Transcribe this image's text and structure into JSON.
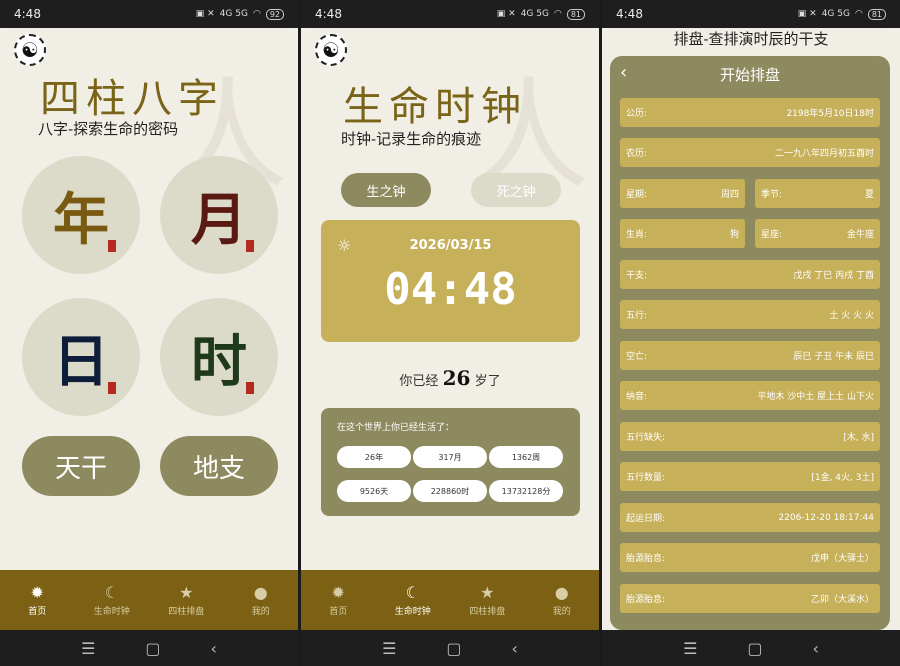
{
  "status": {
    "time": "4:48",
    "battery_1": "92",
    "battery_2": "81",
    "battery_3": "81",
    "signal": "4G 5G"
  },
  "screen1": {
    "title": "四柱八字",
    "subtitle": "八字-探索生命的密码",
    "circles": [
      "年",
      "月",
      "日",
      "时"
    ],
    "pills": [
      "天干",
      "地支"
    ]
  },
  "tabs": [
    {
      "label": "首页",
      "icon": "sun-icon"
    },
    {
      "label": "生命时钟",
      "icon": "moon-icon"
    },
    {
      "label": "四柱排盘",
      "icon": "star-icon"
    },
    {
      "label": "我的",
      "icon": "person-icon"
    }
  ],
  "screen2": {
    "title": "生命时钟",
    "subtitle": "时钟-记录生命的痕迹",
    "btn_life": "生之钟",
    "btn_death": "死之钟",
    "date": "2026/03/15",
    "time": "04:48",
    "age_prefix": "你已经",
    "age_value": "26",
    "age_suffix": "岁了",
    "life_header": "在这个世界上你已经生活了：",
    "life_stats": [
      "26年",
      "317月",
      "1362周",
      "9526天",
      "228860时",
      "13732128分"
    ]
  },
  "screen3": {
    "title": "排盘-查排演时辰的干支",
    "header": "开始排盘",
    "rows": [
      {
        "label": "公历:",
        "value": "2198年5月10日18时"
      },
      {
        "label": "农历:",
        "value": "二一九八年四月初五酉时"
      },
      {
        "label": "星期:",
        "value": "周四",
        "label2": "季节:",
        "value2": "夏"
      },
      {
        "label": "生肖:",
        "value": "狗",
        "label2": "星座:",
        "value2": "金牛座"
      },
      {
        "label": "干支:",
        "value": "戊戌 丁巳 丙戌 丁酉"
      },
      {
        "label": "五行:",
        "value": "土 火 火 火"
      },
      {
        "label": "空亡:",
        "value": "辰巳 子丑 午未 辰巳"
      },
      {
        "label": "纳音:",
        "value": "平地木 沙中土 屋上土 山下火"
      },
      {
        "label": "五行缺失:",
        "value": "[木, 水]"
      },
      {
        "label": "五行数量:",
        "value": "[1金, 4火, 3土]"
      },
      {
        "label": "起运日期:",
        "value": "2206-12-20 18:17:44"
      },
      {
        "label": "胎源胎息:",
        "value": "戊申（大驿土）"
      },
      {
        "label": "胎源胎息:",
        "value": "乙卯（大溪水）"
      }
    ]
  },
  "navbar": [
    "☰",
    "▢",
    "‹"
  ],
  "colors": {
    "gold": "#7c6114",
    "olive": "#8c8a5e",
    "sand": "#c7b05a",
    "paper": "#f1eee5"
  }
}
